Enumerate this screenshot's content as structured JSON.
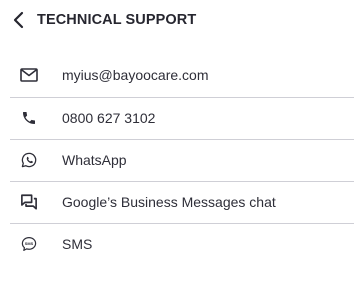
{
  "header": {
    "back_icon": "chevron-left-icon",
    "title": "TECHNICAL SUPPORT"
  },
  "contacts": [
    {
      "icon": "email-icon",
      "label": "myius@bayoocare.com"
    },
    {
      "icon": "phone-icon",
      "label": "0800 627 3102"
    },
    {
      "icon": "whatsapp-icon",
      "label": "WhatsApp"
    },
    {
      "icon": "chat-bubbles-icon",
      "label": "Google’s Business Messages chat"
    },
    {
      "icon": "sms-icon",
      "label": "SMS"
    }
  ],
  "colors": {
    "text": "#2e2e38",
    "divider": "#cfcfd6",
    "background": "#ffffff"
  }
}
